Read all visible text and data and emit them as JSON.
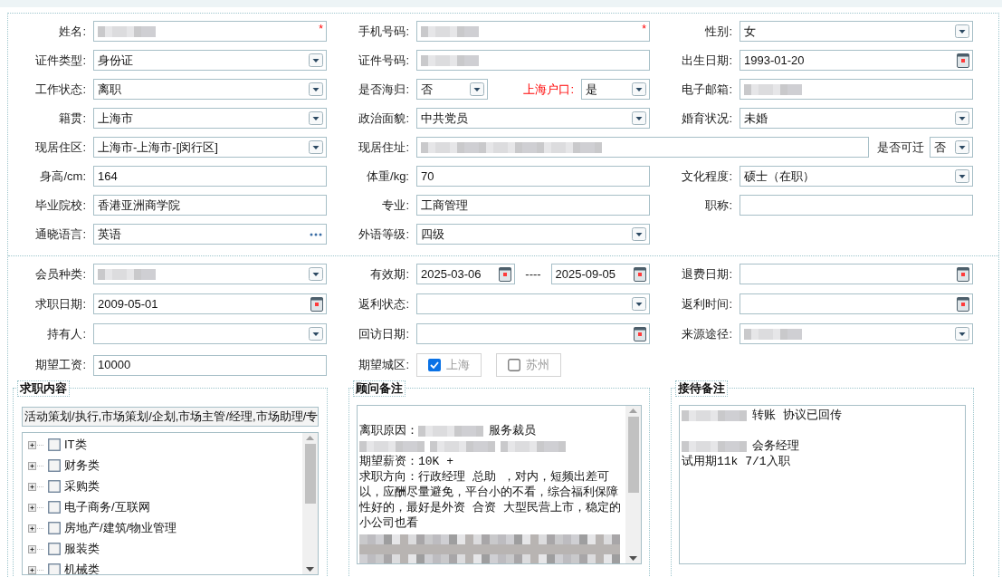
{
  "profile": {
    "rows": [
      [
        {
          "label": "姓名:",
          "field": {
            "kind": "text",
            "redacted": true,
            "required_mark": "*"
          }
        },
        {
          "label": "手机号码:",
          "field": {
            "kind": "text",
            "redacted": true,
            "required_mark": "*"
          }
        },
        {
          "label": "性别:",
          "field": {
            "kind": "select",
            "value": "女"
          }
        }
      ],
      [
        {
          "label": "证件类型:",
          "field": {
            "kind": "select",
            "value": "身份证"
          }
        },
        {
          "label": "证件号码:",
          "field": {
            "kind": "text",
            "redacted": true
          }
        },
        {
          "label": "出生日期:",
          "field": {
            "kind": "date",
            "value": "1993-01-20"
          }
        }
      ],
      [
        {
          "label": "工作状态:",
          "field": {
            "kind": "select",
            "value": "离职"
          }
        },
        {
          "label": "是否海归:",
          "field": {
            "kind": "select",
            "value": "否"
          },
          "trailing": {
            "label": "上海户口:",
            "emphasis": true,
            "field": {
              "kind": "select",
              "value": "是"
            }
          }
        },
        {
          "label": "电子邮箱:",
          "field": {
            "kind": "text",
            "redacted": true
          }
        }
      ],
      [
        {
          "label": "籍贯:",
          "field": {
            "kind": "select",
            "value": "上海市"
          }
        },
        {
          "label": "政治面貌:",
          "field": {
            "kind": "select",
            "value": "中共党员"
          }
        },
        {
          "label": "婚育状况:",
          "field": {
            "kind": "select",
            "value": "未婚"
          }
        }
      ],
      [
        {
          "label": "现居住区:",
          "field": {
            "kind": "select",
            "value": "上海市-上海市-[闵行区]"
          }
        },
        {
          "label": "现居住址:",
          "field": {
            "kind": "text",
            "redacted": true
          },
          "trailing": {
            "label": "是否可迁",
            "emphasis": false,
            "field": {
              "kind": "select",
              "value": "否"
            }
          }
        }
      ],
      [
        {
          "label": "身高/cm:",
          "field": {
            "kind": "text",
            "value": "164"
          }
        },
        {
          "label": "体重/kg:",
          "field": {
            "kind": "text",
            "value": "70"
          }
        },
        {
          "label": "文化程度:",
          "field": {
            "kind": "select",
            "value": "硕士（在职）"
          }
        }
      ],
      [
        {
          "label": "毕业院校:",
          "field": {
            "kind": "text",
            "value": "香港亚洲商学院"
          }
        },
        {
          "label": "专业:",
          "field": {
            "kind": "text",
            "value": "工商管理"
          }
        },
        {
          "label": "职称:",
          "field": {
            "kind": "text"
          }
        }
      ],
      [
        {
          "label": "通晓语言:",
          "field": {
            "kind": "lookup",
            "value": "英语"
          }
        },
        {
          "label": "外语等级:",
          "field": {
            "kind": "select",
            "value": "四级"
          }
        }
      ]
    ]
  },
  "membership": {
    "rows": [
      [
        {
          "label": "会员种类:",
          "field": {
            "kind": "select",
            "redacted": true
          }
        },
        {
          "label": "有效期:",
          "field": {
            "kind": "daterange",
            "from": "2025-03-06",
            "separator": "----",
            "to": "2025-09-05"
          }
        },
        {
          "label": "退费日期:",
          "field": {
            "kind": "date"
          }
        }
      ],
      [
        {
          "label": "求职日期:",
          "field": {
            "kind": "date",
            "value": "2009-05-01"
          }
        },
        {
          "label": "返利状态:",
          "field": {
            "kind": "select"
          }
        },
        {
          "label": "返利时间:",
          "field": {
            "kind": "date"
          }
        }
      ],
      [
        {
          "label": "持有人:",
          "field": {
            "kind": "select"
          }
        },
        {
          "label": "回访日期:",
          "field": {
            "kind": "date"
          }
        },
        {
          "label": "来源途径:",
          "field": {
            "kind": "select",
            "redacted": true
          }
        }
      ],
      [
        {
          "label": "期望工资:",
          "field": {
            "kind": "text",
            "value": "10000"
          }
        },
        {
          "label": "期望城区:",
          "field": {
            "kind": "checkboxes",
            "options": [
              {
                "label": "上海",
                "checked": true
              },
              {
                "label": "苏州",
                "checked": false
              }
            ]
          }
        }
      ]
    ]
  },
  "job_content": {
    "title": "求职内容",
    "selection": "活动策划/执行,市场策划/企划,市场主管/经理,市场助理/专",
    "tree": [
      {
        "label": "IT类",
        "expanded": false,
        "checked": false
      },
      {
        "label": "财务类",
        "expanded": false,
        "checked": false
      },
      {
        "label": "采购类",
        "expanded": false,
        "checked": false
      },
      {
        "label": "电子商务/互联网",
        "expanded": false,
        "checked": false
      },
      {
        "label": "房地产/建筑/物业管理",
        "expanded": false,
        "checked": false
      },
      {
        "label": "服装类",
        "expanded": false,
        "checked": false
      },
      {
        "label": "机械类",
        "expanded": false,
        "checked": false
      }
    ]
  },
  "notes": [
    {
      "title": "顾问备注",
      "scrollable": true,
      "paragraphs": [
        {
          "spaced": true,
          "parts": [
            {
              "kind": "text",
              "text": "离职原因："
            },
            {
              "kind": "redacted"
            },
            {
              "kind": "text",
              "text": "服务裁员"
            }
          ]
        },
        {
          "spaced": false,
          "parts": [
            {
              "kind": "redacted"
            },
            {
              "kind": "redacted"
            },
            {
              "kind": "redacted"
            }
          ]
        },
        {
          "spaced": false,
          "parts": [
            {
              "kind": "text",
              "text": "期望薪资：10K +"
            }
          ]
        },
        {
          "spaced": false,
          "parts": [
            {
              "kind": "text",
              "text": "求职方向：行政经理 总助 ，对内，短频出差可以，应酬尽量避免，平台小的不看，综合福利保障性好的，最好是外资 合资 大型民营上市，稳定的小公司也看"
            }
          ]
        },
        {
          "spaced": false,
          "parts": [
            {
              "kind": "redacted_block"
            }
          ]
        }
      ]
    },
    {
      "title": "接待备注",
      "scrollable": false,
      "paragraphs": [
        {
          "spaced": false,
          "parts": [
            {
              "kind": "redacted"
            },
            {
              "kind": "text",
              "text": "转账 协议已回传"
            }
          ]
        },
        {
          "spaced": true,
          "parts": [
            {
              "kind": "redacted"
            },
            {
              "kind": "text",
              "text": "会务经理"
            }
          ]
        },
        {
          "spaced": false,
          "parts": [
            {
              "kind": "text",
              "text": "试用期11k 7/1入职"
            }
          ]
        }
      ]
    }
  ]
}
